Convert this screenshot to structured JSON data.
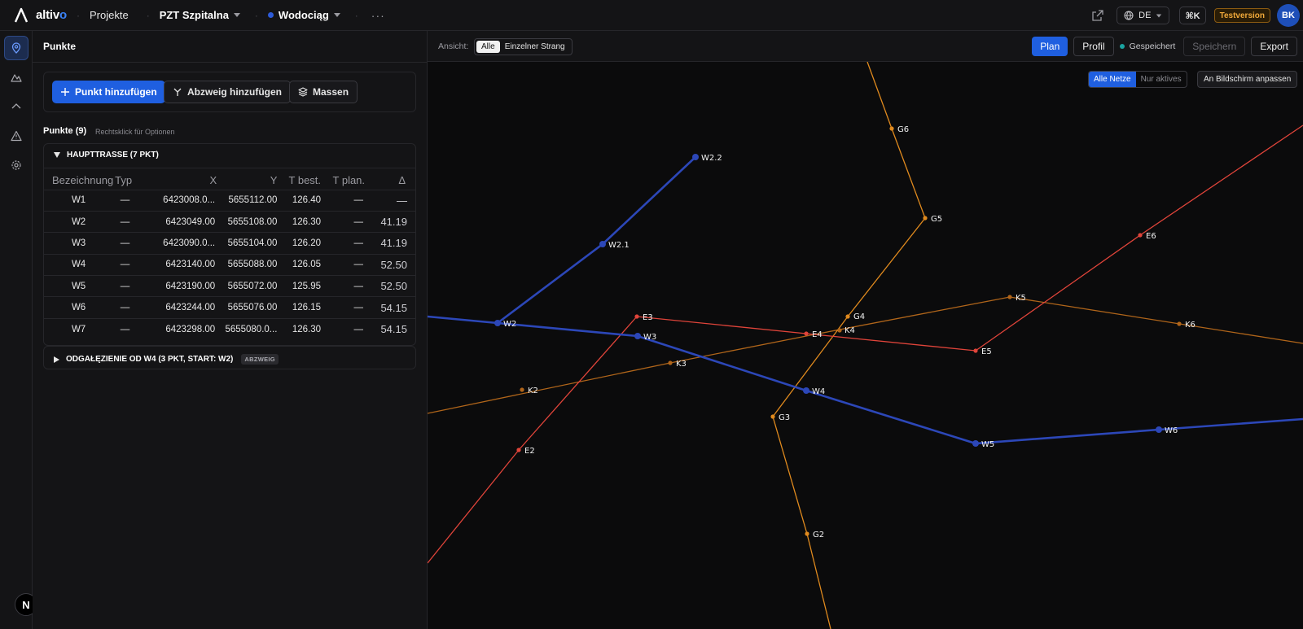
{
  "app": {
    "brand": "altiv",
    "brand_accent": "o",
    "nav_projects": "Projekte",
    "project": "PZT Szpitalna",
    "network": "Wodociąg",
    "more": "···"
  },
  "topright": {
    "lang": "DE",
    "shortcut": "⌘K",
    "trial": "Testversion",
    "avatar": "BK"
  },
  "rail": {
    "badge": "N"
  },
  "panel": {
    "title": "Punkte",
    "add_point": "Punkt hinzufügen",
    "add_branch": "Abzweig hinzufügen",
    "masses": "Massen",
    "points_title": "Punkte (9)",
    "points_hint": "Rechtsklick für Optionen",
    "group1": "HAUPTTRASSE (7 PKT)",
    "group2": "ODGAŁĘZIENIE OD W4 (3 PKT, START: W2)",
    "group2_badge": "ABZWEIG",
    "columns": [
      "Bezeichnung",
      "Typ",
      "X",
      "Y",
      "T best.",
      "T plan.",
      "Δ"
    ],
    "rows": [
      {
        "name": "W1",
        "typ": "—",
        "x": "6423008.0...",
        "y": "5655112.00",
        "tbest": "126.40",
        "tplan": "—",
        "delta": "—"
      },
      {
        "name": "W2",
        "typ": "—",
        "x": "6423049.00",
        "y": "5655108.00",
        "tbest": "126.30",
        "tplan": "—",
        "delta": "41.19"
      },
      {
        "name": "W3",
        "typ": "—",
        "x": "6423090.0...",
        "y": "5655104.00",
        "tbest": "126.20",
        "tplan": "—",
        "delta": "41.19"
      },
      {
        "name": "W4",
        "typ": "—",
        "x": "6423140.00",
        "y": "5655088.00",
        "tbest": "126.05",
        "tplan": "—",
        "delta": "52.50"
      },
      {
        "name": "W5",
        "typ": "—",
        "x": "6423190.00",
        "y": "5655072.00",
        "tbest": "125.95",
        "tplan": "—",
        "delta": "52.50"
      },
      {
        "name": "W6",
        "typ": "—",
        "x": "6423244.00",
        "y": "5655076.00",
        "tbest": "126.15",
        "tplan": "—",
        "delta": "54.15"
      },
      {
        "name": "W7",
        "typ": "—",
        "x": "6423298.00",
        "y": "5655080.0...",
        "tbest": "126.30",
        "tplan": "—",
        "delta": "54.15"
      }
    ]
  },
  "toolbar": {
    "view_label": "Ansicht:",
    "view_all": "Alle",
    "view_single": "Einzelner Strang",
    "plan": "Plan",
    "profil": "Profil",
    "saved": "Gespeichert",
    "save": "Speichern",
    "export": "Export"
  },
  "map": {
    "all_nets": "Alle Netze",
    "only_active": "Nur aktives",
    "fit": "An Bildschirm anpassen",
    "colors": {
      "water": "#2c47b8",
      "electric": "#e0443a",
      "gas": "#e08a1e",
      "sewer": "#b0651a"
    },
    "labels": {
      "W2": "W2",
      "W2_1": "W2.1",
      "W2_2": "W2.2",
      "W3": "W3",
      "W4": "W4",
      "W5": "W5",
      "W6": "W6",
      "E2": "E2",
      "E3": "E3",
      "E4": "E4",
      "E5": "E5",
      "E6": "E6",
      "G2": "G2",
      "G3": "G3",
      "G4": "G4",
      "G5": "G5",
      "G6": "G6",
      "K2": "K2",
      "K3": "K3",
      "K4": "K4",
      "K5": "K5",
      "K6": "K6"
    }
  }
}
